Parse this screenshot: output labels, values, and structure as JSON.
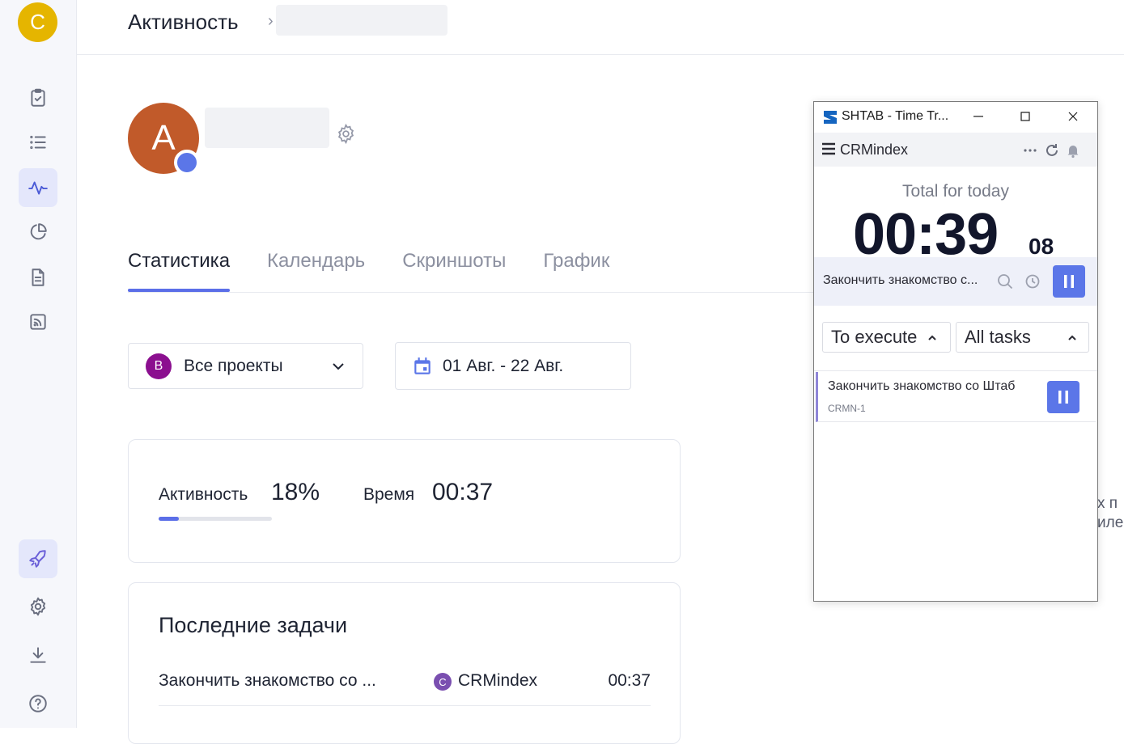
{
  "sidebar": {
    "user_initial": "C",
    "items": [
      {
        "name": "tasks",
        "icon": "clipboard-check-icon"
      },
      {
        "name": "list",
        "icon": "list-icon"
      },
      {
        "name": "activity",
        "icon": "activity-icon",
        "active": true
      },
      {
        "name": "reports",
        "icon": "pie-chart-icon"
      },
      {
        "name": "documents",
        "icon": "document-icon"
      },
      {
        "name": "feed",
        "icon": "rss-icon"
      }
    ],
    "bottom_items": [
      {
        "name": "rocket",
        "icon": "rocket-icon"
      },
      {
        "name": "settings",
        "icon": "gear-icon"
      },
      {
        "name": "download",
        "icon": "download-icon"
      },
      {
        "name": "help",
        "icon": "help-circle-icon"
      }
    ]
  },
  "header": {
    "title": "Активность",
    "separator": "›"
  },
  "profile": {
    "initial": "A",
    "avatar_color": "#c15a2a",
    "status_color": "#5b76e8"
  },
  "tabs": [
    "Статистика",
    "Календарь",
    "Скриншоты",
    "График"
  ],
  "filters": {
    "project_badge": "B",
    "project_label": "Все проекты",
    "date_range": "01 Авг. - 22 Авг."
  },
  "stats": {
    "activity_label": "Активность",
    "activity_value": "18%",
    "activity_percent": 18,
    "time_label": "Время",
    "time_value": "00:37"
  },
  "recent": {
    "title": "Последние задачи",
    "rows": [
      {
        "task": "Закончить знакомство со ...",
        "project_badge": "C",
        "project": "CRMindex",
        "time": "00:37"
      }
    ]
  },
  "cut_text": [
    "х п",
    "иле"
  ],
  "tracker": {
    "window_title": "SHTAB - Time Tr...",
    "project": "CRMindex",
    "total_label": "Total for today",
    "total_time": "00:39",
    "total_seconds": "08",
    "current_task": "Закончить знакомство с...",
    "filter_status": "To execute",
    "filter_tasks": "All tasks",
    "task": {
      "name": "Закончить знакомство со Штаб",
      "code": "CRMN-1"
    },
    "accent": "#5b76e8"
  }
}
